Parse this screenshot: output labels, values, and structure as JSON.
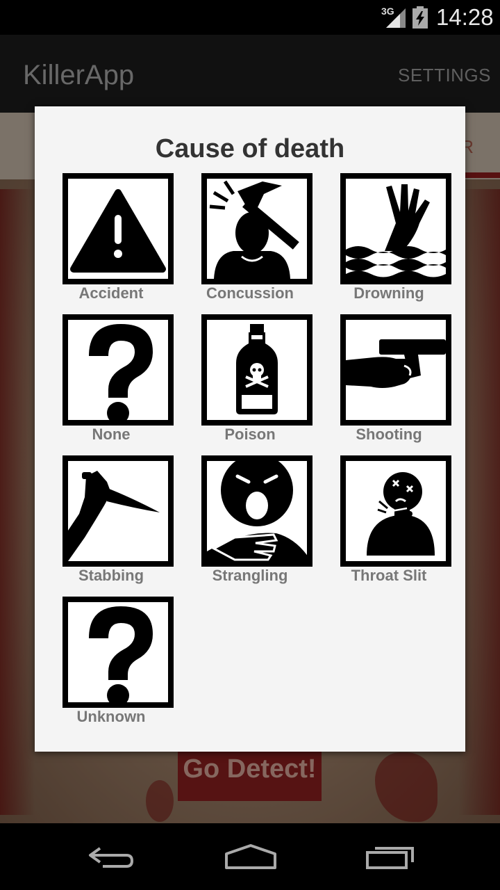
{
  "status_bar": {
    "network": "3G",
    "time": "14:28"
  },
  "action_bar": {
    "title": "KillerApp",
    "settings_label": "SETTINGS"
  },
  "background": {
    "tab_partial_text": "R",
    "detect_button": "Go Detect!"
  },
  "dialog": {
    "title": "Cause of death",
    "options": [
      {
        "label": "Accident",
        "icon": "warning-triangle-icon"
      },
      {
        "label": "Concussion",
        "icon": "hammer-head-icon"
      },
      {
        "label": "Drowning",
        "icon": "drowning-hand-icon"
      },
      {
        "label": "None",
        "icon": "question-mark-icon"
      },
      {
        "label": "Poison",
        "icon": "poison-bottle-icon"
      },
      {
        "label": "Shooting",
        "icon": "pistol-hand-icon"
      },
      {
        "label": "Stabbing",
        "icon": "knife-hand-icon"
      },
      {
        "label": "Strangling",
        "icon": "strangled-face-icon"
      },
      {
        "label": "Throat Slit",
        "icon": "throat-slit-icon"
      },
      {
        "label": "Unknown",
        "icon": "question-mark-icon"
      }
    ]
  },
  "colors": {
    "accent_red": "#8c1f1f",
    "dialog_bg": "#f4f4f4",
    "label_gray": "#777777"
  }
}
